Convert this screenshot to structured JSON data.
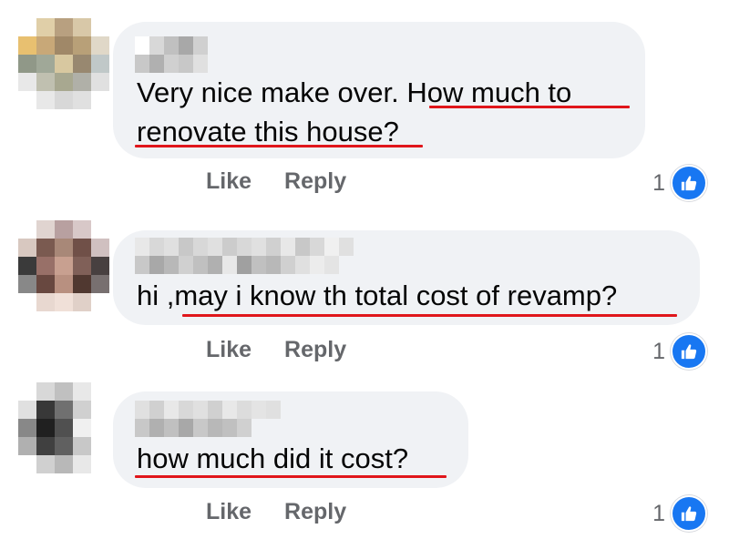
{
  "colors": {
    "bubble_bg": "#f0f2f5",
    "text": "#050505",
    "secondary_text": "#65676b",
    "like_blue": "#1877f2",
    "annotation_red": "#e0161b"
  },
  "icons": {
    "reaction": "thumbs-up-icon"
  },
  "comments": [
    {
      "author": "[pixelated name]",
      "line1_plain": "Very nice make over. ",
      "line1_marked": "How much to",
      "line2_marked": "renovate this house?",
      "like_label": "Like",
      "reply_label": "Reply",
      "reaction_count": "1"
    },
    {
      "author": "[pixelated name]",
      "line1_plain": "hi ,",
      "line1_marked": "may i know th total cost of revamp?",
      "like_label": "Like",
      "reply_label": "Reply",
      "reaction_count": "1"
    },
    {
      "author": "[pixelated name]",
      "line1_marked": "how much did it cost?",
      "like_label": "Like",
      "reply_label": "Reply",
      "reaction_count": "1"
    }
  ]
}
